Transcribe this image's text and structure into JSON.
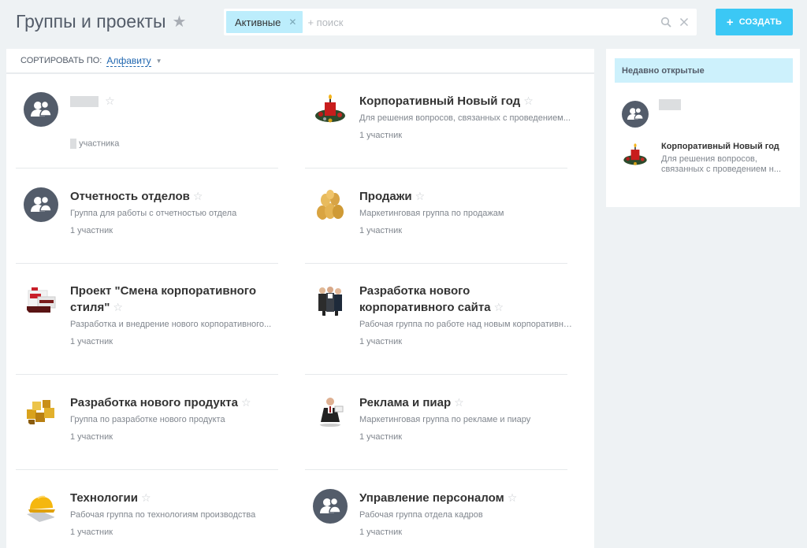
{
  "header": {
    "title": "Группы и проекты",
    "filter_chip": "Активные",
    "search_placeholder": "+ поиск",
    "create_label": "СОЗДАТЬ"
  },
  "sort": {
    "label": "СОРТИРОВАТЬ ПО:",
    "value": "Алфавиту"
  },
  "groups": [
    {
      "title": "",
      "description": "",
      "members": "участника",
      "avatar": "generic-users-icon",
      "redacted": true
    },
    {
      "title": "Корпоративный Новый год",
      "description": "Для решения вопросов, связанных с проведением...",
      "members": "1 участник",
      "avatar": "christmas-candle-image"
    },
    {
      "title": "Отчетность отделов",
      "description": "Группа для работы с отчетностью отдела",
      "members": "1 участник",
      "avatar": "generic-users-icon"
    },
    {
      "title": "Продажи",
      "description": "Маркетинговая группа по продажам",
      "members": "1 участник",
      "avatar": "coins-image"
    },
    {
      "title": "Проект \"Смена корпоративного стиля\"",
      "description": "Разработка и внедрение нового корпоративного...",
      "members": "1 участник",
      "avatar": "brand-materials-image"
    },
    {
      "title": "Разработка нового корпоративного сайта",
      "description": "Рабочая группа по работе над новым корпоративным...",
      "members": "1 участник",
      "avatar": "team-people-image"
    },
    {
      "title": "Разработка нового продукта",
      "description": "Группа по разработке нового продукта",
      "members": "1 участник",
      "avatar": "cubes-image"
    },
    {
      "title": "Реклама и пиар",
      "description": "Маркетинговая группа по рекламе и пиару",
      "members": "1 участник",
      "avatar": "businessman-image"
    },
    {
      "title": "Технологии",
      "description": "Рабочая группа по технологиям производства",
      "members": "1 участник",
      "avatar": "hardhat-image"
    },
    {
      "title": "Управление персоналом",
      "description": "Рабочая группа отдела кадров",
      "members": "1 участник",
      "avatar": "generic-users-icon"
    }
  ],
  "recent": {
    "heading": "Недавно открытые",
    "items": [
      {
        "title": "",
        "description": "",
        "avatar": "generic-users-icon",
        "redacted": true
      },
      {
        "title": "Корпоративный Новый год",
        "description": "Для решения вопросов, связанных с проведением н...",
        "avatar": "christmas-candle-image"
      }
    ]
  },
  "colors": {
    "accent": "#3bc8f5",
    "chip": "#bcedfc",
    "recent_head": "#cdf1fc",
    "avatar": "#535c6a",
    "link": "#2067b0"
  }
}
